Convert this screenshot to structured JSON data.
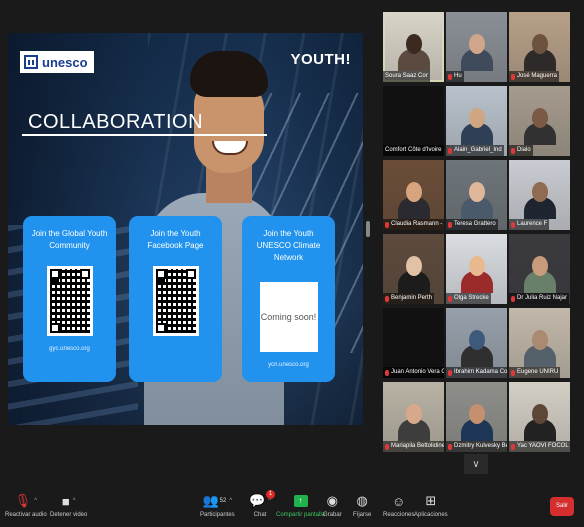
{
  "slide": {
    "logo": "unesco",
    "badge": "YOUTH!",
    "heading": "COLLABORATION",
    "cards": [
      {
        "title": "Join the Global Youth Community",
        "url": "gyc.unesco.org",
        "kind": "qr"
      },
      {
        "title": "Join the Youth Facebook Page",
        "url": "",
        "kind": "qr"
      },
      {
        "title": "Join the Youth UNESCO Climate Network",
        "url": "ycn.unesco.org",
        "kind": "placeholder",
        "placeholder": "Coming soon!"
      }
    ]
  },
  "gallery": {
    "participants": [
      {
        "name": "Soura Saaz Cor",
        "video": true,
        "muted": false,
        "active": true
      },
      {
        "name": "Hu",
        "video": true,
        "muted": true
      },
      {
        "name": "José Maguerra",
        "video": true,
        "muted": true
      },
      {
        "name": "Comfort Côte d'Ivoire",
        "video": false,
        "muted": false
      },
      {
        "name": "Alain_Gabriel_Ind",
        "video": true,
        "muted": true
      },
      {
        "name": "Dialo",
        "video": true,
        "muted": true
      },
      {
        "name": "Claudia Rasmann - A",
        "video": true,
        "muted": true
      },
      {
        "name": "Teresa Grattero",
        "video": true,
        "muted": true
      },
      {
        "name": "Laurence F",
        "video": true,
        "muted": true
      },
      {
        "name": "Benjamin Perth",
        "video": true,
        "muted": true
      },
      {
        "name": "Olga Strecke",
        "video": true,
        "muted": true
      },
      {
        "name": "Dr Julia Ruiz Najar",
        "video": true,
        "muted": true
      },
      {
        "name": "Juan Antonio Vera Cas",
        "video": false,
        "muted": true
      },
      {
        "name": "Ibrahim Kadama Comb",
        "video": true,
        "muted": true
      },
      {
        "name": "Eugene UNIRU",
        "video": true,
        "muted": true
      },
      {
        "name": "Mariapila Bettolidine",
        "video": true,
        "muted": true
      },
      {
        "name": "Dzmitry Kulvesky Bel",
        "video": true,
        "muted": true
      },
      {
        "name": "Yac YAOVI FOCOL",
        "video": true,
        "muted": true
      }
    ],
    "more": "∨"
  },
  "toolbar": {
    "mute": "Reactivar audio",
    "video": "Detener video",
    "participants": "Participantes",
    "participants_count": "52",
    "chat": "Chat",
    "chat_badge": "1",
    "share": "Compartir pantalla",
    "record": "Grabar",
    "captions": "Fíjarse",
    "reactions": "Reacciones",
    "apps": "Aplicaciones",
    "leave": "Salir"
  },
  "colors": {
    "active": "#c7df57",
    "share": "#22b14c",
    "leave": "#d42e2e",
    "card": "#2193ee"
  }
}
